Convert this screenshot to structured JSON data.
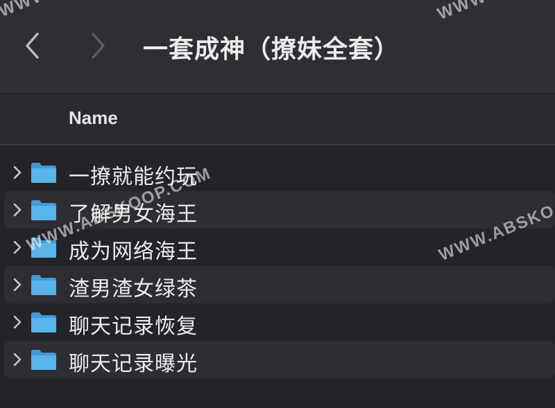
{
  "toolbar": {
    "title": "一套成神（撩妹全套）",
    "back_icon": "chevron-left-icon",
    "forward_icon": "chevron-right-icon"
  },
  "columns": {
    "name_label": "Name"
  },
  "files": [
    {
      "name": "一撩就能约玩",
      "icon": "folder-icon"
    },
    {
      "name": "了解男女海王",
      "icon": "folder-icon"
    },
    {
      "name": "成为网络海王",
      "icon": "folder-icon"
    },
    {
      "name": "渣男渣女绿茶",
      "icon": "folder-icon"
    },
    {
      "name": "聊天记录恢复",
      "icon": "folder-icon"
    },
    {
      "name": "聊天记录曝光",
      "icon": "folder-icon"
    }
  ],
  "watermarks": {
    "top_left": "WWW.",
    "top_right": "WWW.",
    "middle_left": "WWW.ABSKOOP.COM",
    "middle_right": "WWW.ABSKO"
  },
  "colors": {
    "folder": "#4aa8e0",
    "background": "#242428",
    "toolbar": "#2f2f33"
  }
}
